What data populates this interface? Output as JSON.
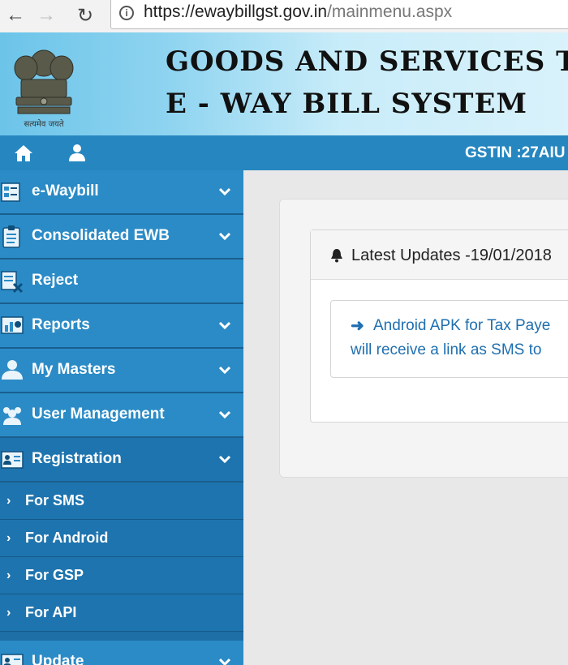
{
  "browser": {
    "url_host": "https://ewaybillgst.gov.in",
    "url_path": "/mainmenu.aspx",
    "back_glyph": "←",
    "forward_glyph": "→",
    "reload_glyph": "↻",
    "info_glyph": "i"
  },
  "banner": {
    "title_line1": "GOODS AND SERVICES TAX",
    "title_line2": "E - WAY BILL SYSTEM",
    "emblem_motto": "सत्यमेव जयते"
  },
  "topnav": {
    "gstin": "GSTIN :27AIU"
  },
  "sidebar": {
    "items": [
      {
        "label": "e-Waybill",
        "icon": "document-list-icon",
        "expandable": true
      },
      {
        "label": "Consolidated EWB",
        "icon": "clipboard-icon",
        "expandable": true
      },
      {
        "label": "Reject",
        "icon": "reject-doc-icon",
        "expandable": false
      },
      {
        "label": "Reports",
        "icon": "chart-report-icon",
        "expandable": true
      },
      {
        "label": "My Masters",
        "icon": "masters-user-icon",
        "expandable": true
      },
      {
        "label": "User Management",
        "icon": "users-group-icon",
        "expandable": true
      },
      {
        "label": "Registration",
        "icon": "id-card-icon",
        "expandable": true,
        "expanded": true
      }
    ],
    "registration_sub": [
      {
        "label": "For SMS",
        "caret": "›"
      },
      {
        "label": "For Android",
        "caret": "›"
      },
      {
        "label": "For GSP",
        "caret": "›"
      },
      {
        "label": "For API",
        "caret": "›"
      }
    ],
    "update": {
      "label": "Update",
      "icon": "id-card-icon",
      "expandable": true
    }
  },
  "updates": {
    "title": "Latest Updates -19/01/2018",
    "notice_arrow": "➜",
    "notice_line1": "Android APK for Tax Paye",
    "notice_line2": "will receive a link as SMS to"
  },
  "colors": {
    "sidebar_item": "#2b8bc6",
    "sidebar_active": "#1e74ae",
    "topnav": "#2686c0",
    "link": "#1f6fb0"
  }
}
